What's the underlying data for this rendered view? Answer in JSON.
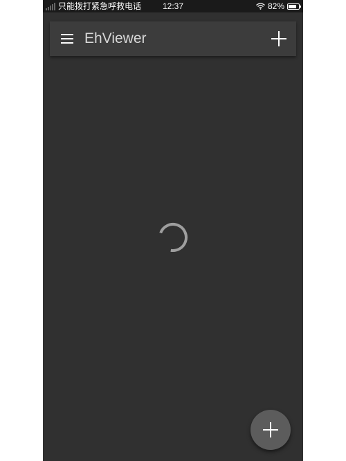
{
  "status_bar": {
    "carrier_text": "只能拨打紧急呼救电话",
    "time": "12:37",
    "battery_percent": "82%",
    "battery_level": 0.82,
    "icons": [
      "signal-icon",
      "wifi-icon",
      "battery-icon"
    ]
  },
  "toolbar": {
    "title": "EhViewer",
    "left_icon": "menu-icon",
    "right_icon": "add-icon"
  },
  "content": {
    "state": "loading",
    "icon": "loading-spinner-icon"
  },
  "fab": {
    "icon": "add-icon"
  },
  "colors": {
    "background": "#303030",
    "toolbar": "#3c3c3c",
    "status_bar": "#1a1a1a",
    "fab": "#5c5c5c",
    "spinner": "#9e9e9e",
    "title_text": "#d8d8d8"
  }
}
